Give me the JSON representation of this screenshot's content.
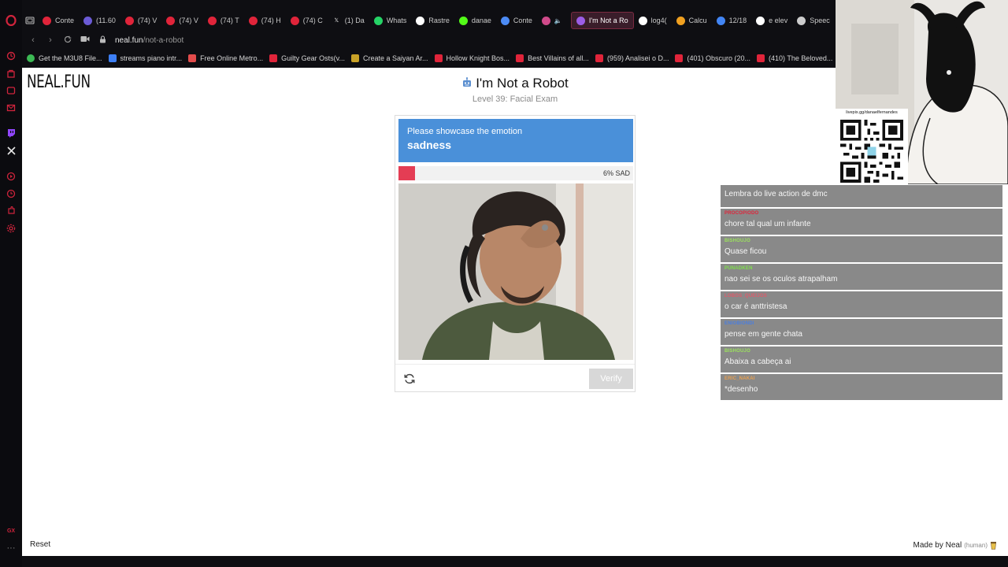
{
  "browser": {
    "tabs": [
      {
        "label": "Conte",
        "favicon": "youtube-icon",
        "color": "#e0243a"
      },
      {
        "label": "(11.60",
        "favicon": "mediaplayer-icon",
        "color": "#6b5bd6"
      },
      {
        "label": "(74) V",
        "favicon": "youtube-icon",
        "color": "#e0243a"
      },
      {
        "label": "(74) V",
        "favicon": "youtube-icon",
        "color": "#e0243a"
      },
      {
        "label": "(74) T",
        "favicon": "youtube-icon",
        "color": "#e0243a"
      },
      {
        "label": "(74) H",
        "favicon": "youtube-icon",
        "color": "#e0243a"
      },
      {
        "label": "(74) C",
        "favicon": "youtube-icon",
        "color": "#e0243a"
      },
      {
        "label": "(1) Da",
        "favicon": "x-icon",
        "color": "#000000"
      },
      {
        "label": "Whats",
        "favicon": "whatsapp-icon",
        "color": "#25d366"
      },
      {
        "label": "Rastre",
        "favicon": "tracking-icon",
        "color": "#ffffff"
      },
      {
        "label": "danae",
        "favicon": "kick-icon",
        "color": "#53fc18"
      },
      {
        "label": "Conte",
        "favicon": "docs-icon",
        "color": "#4c8bf5"
      },
      {
        "label": "",
        "favicon": "audio-icon",
        "color": "#d04a8a"
      },
      {
        "label": "I'm Not a Ro",
        "favicon": "robot-icon",
        "color": "#9b5de5",
        "active": true
      },
      {
        "label": "log4(",
        "favicon": "google-icon",
        "color": "#ffffff"
      },
      {
        "label": "Calcu",
        "favicon": "calculator-icon",
        "color": "#f0a020"
      },
      {
        "label": "12/18",
        "favicon": "chrome-icon",
        "color": "#4285f4"
      },
      {
        "label": "e elev",
        "favicon": "google-icon",
        "color": "#ffffff"
      },
      {
        "label": "Speec",
        "favicon": "grid-icon",
        "color": "#cccccc"
      }
    ],
    "address": {
      "domain": "neal.fun",
      "path": "/not-a-robot"
    },
    "bookmarks": [
      {
        "label": "Get the M3U8 File...",
        "favicon": "green-circle-icon",
        "color": "#3cba54"
      },
      {
        "label": "streams piano intr...",
        "favicon": "dropbox-icon",
        "color": "#3d7ff5"
      },
      {
        "label": "Free Online Metro...",
        "favicon": "shield-icon",
        "color": "#e34c4c"
      },
      {
        "label": "Guilty Gear Osts(v...",
        "favicon": "u-icon",
        "color": "#e0243a"
      },
      {
        "label": "Create a Saiyan Ar...",
        "favicon": "pencil-icon",
        "color": "#c9a227"
      },
      {
        "label": "Hollow Knight Bos...",
        "favicon": "u-icon",
        "color": "#e0243a"
      },
      {
        "label": "Best Villains of all...",
        "favicon": "u-icon",
        "color": "#e0243a"
      },
      {
        "label": "(959) Analisei o D...",
        "favicon": "youtube-icon",
        "color": "#e0243a"
      },
      {
        "label": "(401) Obscuro (20...",
        "favicon": "youtube-icon",
        "color": "#e0243a"
      },
      {
        "label": "(410) The Beloved...",
        "favicon": "youtube-icon",
        "color": "#e0243a"
      }
    ]
  },
  "page": {
    "logo": "NEAL.FUN",
    "title": "I'm Not a Robot",
    "level": "Level 39: Facial Exam",
    "captcha": {
      "prompt": "Please showcase the emotion",
      "emotion": "sadness",
      "meter_percent": 6,
      "meter_label": "6% SAD",
      "meter_color": "#e43d54",
      "header_color": "#4a90d9",
      "verify_label": "Verify"
    },
    "reset_label": "Reset",
    "made_by": "Made by Neal",
    "made_by_note": "(human)"
  },
  "chat": {
    "messages": [
      {
        "user": "",
        "text": "Lembra do live action de dmc",
        "color": "#e8a050"
      },
      {
        "user": "PROCOPIODO",
        "text": "chore tal qual um infante",
        "color": "#e0243a"
      },
      {
        "user": "BISHOUJO",
        "text": "Quase ficou",
        "color": "#9be35b"
      },
      {
        "user": "PUNADKEN",
        "text": "nao sei se os oculos atrapalham",
        "color": "#7ee04a"
      },
      {
        "user": "LOBOS_QUEIJOS",
        "text": "o car é anttristesa",
        "color": "#e05a6a"
      },
      {
        "user": "ENIOBIONDI",
        "text": "pense em gente chata",
        "color": "#4a7ee0"
      },
      {
        "user": "BISHOUJO",
        "text": "Abaixa a cabeça ai",
        "color": "#9be35b"
      },
      {
        "user": "ERIC_NAKAI",
        "text": "*desenho",
        "color": "#e8a050"
      }
    ]
  },
  "stream": {
    "qr_text": "livepix.gg/danaelfernandes"
  }
}
